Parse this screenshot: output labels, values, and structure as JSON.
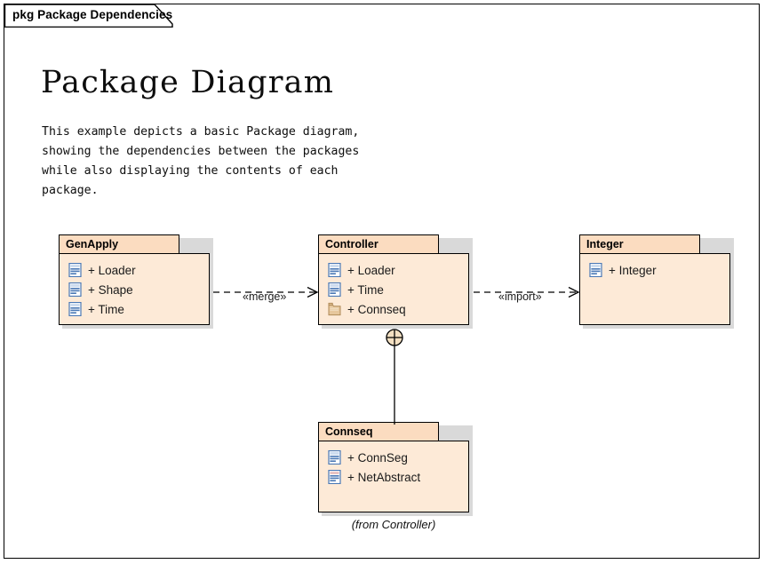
{
  "frame": {
    "keyword": "pkg",
    "name": "Package Dependencies",
    "tab_label": "pkg Package Dependencies"
  },
  "title": "Package Diagram",
  "description": "This example depicts a basic Package diagram,\nshowing the dependencies between the packages\nwhile also displaying the contents of each\npackage.",
  "colors": {
    "package_header_fill": "#fbdcc0",
    "package_body_fill": "#fdead7",
    "package_border": "#000000",
    "shadow": "#d9d9d9",
    "class_icon_blue": "#4a78b5",
    "folder_icon_tan": "#c8a173",
    "canvas": "#ffffff"
  },
  "packages": [
    {
      "id": "genapply",
      "name": "GenApply",
      "caption": "",
      "members": [
        {
          "visibility": "+",
          "label": "+ Loader",
          "icon": "class-icon"
        },
        {
          "visibility": "+",
          "label": "+ Shape",
          "icon": "class-icon"
        },
        {
          "visibility": "+",
          "label": "+ Time",
          "icon": "class-icon"
        }
      ]
    },
    {
      "id": "controller",
      "name": "Controller",
      "caption": "",
      "members": [
        {
          "visibility": "+",
          "label": "+ Loader",
          "icon": "class-icon"
        },
        {
          "visibility": "+",
          "label": "+ Time",
          "icon": "class-icon"
        },
        {
          "visibility": "+",
          "label": "+ Connseq",
          "icon": "package-folder-icon"
        }
      ]
    },
    {
      "id": "integer",
      "name": "Integer",
      "caption": "",
      "members": [
        {
          "visibility": "+",
          "label": "+ Integer",
          "icon": "class-icon"
        }
      ]
    },
    {
      "id": "connseq",
      "name": "Connseq",
      "caption": "(from Controller)",
      "members": [
        {
          "visibility": "+",
          "label": "+ ConnSeg",
          "icon": "class-icon"
        },
        {
          "visibility": "+",
          "label": "+ NetAbstract",
          "icon": "class-icon"
        }
      ]
    }
  ],
  "connectors": [
    {
      "id": "merge",
      "stereotype": "«merge»",
      "from": "GenApply",
      "to": "Controller",
      "style": "dashed-open-arrow"
    },
    {
      "id": "import",
      "stereotype": "«import»",
      "from": "Controller",
      "to": "Integer",
      "style": "dashed-open-arrow"
    },
    {
      "id": "containment",
      "stereotype": "",
      "from": "Controller",
      "to": "Connseq",
      "style": "containment-circle-plus"
    }
  ]
}
